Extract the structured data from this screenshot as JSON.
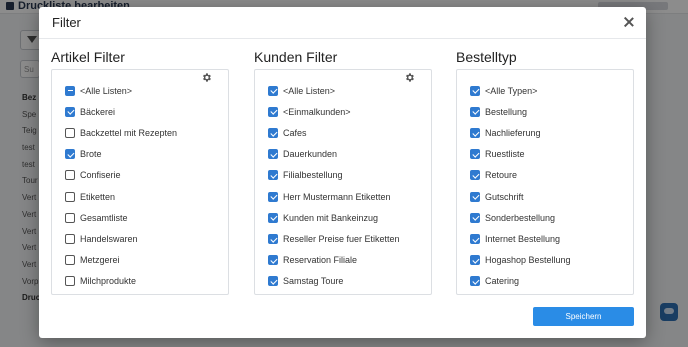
{
  "background": {
    "title": "Druckliste bearbeiten",
    "search_placeholder": "Su",
    "list_items": [
      "Bez",
      "Spe",
      "Teig",
      "test",
      "test",
      "Tour",
      "Vert",
      "Vert",
      "Vert",
      "Vert",
      "Vert",
      "Vorp",
      "Druc"
    ]
  },
  "modal": {
    "title": "Filter",
    "save_label": "Speichern",
    "columns": [
      {
        "title": "Artikel Filter",
        "items": [
          {
            "label": "<Alle Listen>",
            "state": "indeterminate"
          },
          {
            "label": "Bäckerei",
            "state": "checked"
          },
          {
            "label": "Backzettel mit Rezepten",
            "state": "unchecked"
          },
          {
            "label": "Brote",
            "state": "checked"
          },
          {
            "label": "Confiserie",
            "state": "unchecked"
          },
          {
            "label": "Etiketten",
            "state": "unchecked"
          },
          {
            "label": "Gesamtliste",
            "state": "unchecked"
          },
          {
            "label": "Handelswaren",
            "state": "unchecked"
          },
          {
            "label": "Metzgerei",
            "state": "unchecked"
          },
          {
            "label": "Milchprodukte",
            "state": "unchecked"
          }
        ]
      },
      {
        "title": "Kunden Filter",
        "items": [
          {
            "label": "<Alle Listen>",
            "state": "checked"
          },
          {
            "label": "<Einmalkunden>",
            "state": "checked"
          },
          {
            "label": "Cafes",
            "state": "checked"
          },
          {
            "label": "Dauerkunden",
            "state": "checked"
          },
          {
            "label": "Filialbestellung",
            "state": "checked"
          },
          {
            "label": "Herr Mustermann Etiketten",
            "state": "checked"
          },
          {
            "label": "Kunden mit Bankeinzug",
            "state": "checked"
          },
          {
            "label": "Reseller Preise fuer Etiketten",
            "state": "checked"
          },
          {
            "label": "Reservation Filiale",
            "state": "checked"
          },
          {
            "label": "Samstag Toure",
            "state": "checked"
          }
        ]
      },
      {
        "title": "Bestelltyp",
        "items": [
          {
            "label": "<Alle Typen>",
            "state": "checked"
          },
          {
            "label": "Bestellung",
            "state": "checked"
          },
          {
            "label": "Nachlieferung",
            "state": "checked"
          },
          {
            "label": "Ruestliste",
            "state": "checked"
          },
          {
            "label": "Retoure",
            "state": "checked"
          },
          {
            "label": "Gutschrift",
            "state": "checked"
          },
          {
            "label": "Sonderbestellung",
            "state": "checked"
          },
          {
            "label": "Internet Bestellung",
            "state": "checked"
          },
          {
            "label": "Hogashop Bestellung",
            "state": "checked"
          },
          {
            "label": "Catering",
            "state": "checked"
          }
        ]
      }
    ]
  },
  "colors": {
    "accent": "#2f7ad0",
    "button": "#2a8ce6"
  }
}
